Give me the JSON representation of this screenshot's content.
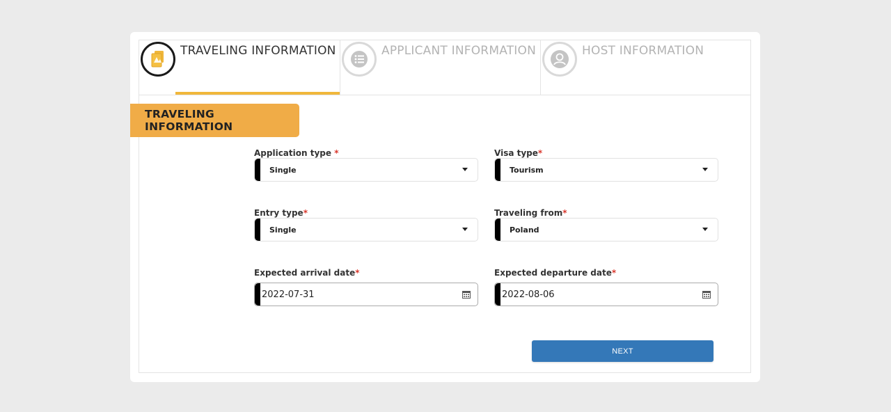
{
  "steps": [
    {
      "label": "TRAVELING INFORMATION",
      "icon": "passport-document-icon",
      "state": "active"
    },
    {
      "label": "APPLICANT INFORMATION",
      "icon": "list-icon",
      "state": "inactive"
    },
    {
      "label": "HOST INFORMATION",
      "icon": "user-icon",
      "state": "inactive"
    }
  ],
  "section": {
    "title": "TRAVELING INFORMATION"
  },
  "fields": {
    "application_type": {
      "label": "Application type ",
      "required": "*",
      "value": "Single"
    },
    "visa_type": {
      "label": "Visa type",
      "required": "*",
      "value": "Tourism"
    },
    "entry_type": {
      "label": "Entry type",
      "required": "*",
      "value": "Single"
    },
    "traveling_from": {
      "label": "Traveling from",
      "required": "*",
      "value": "Poland"
    },
    "arrival_date": {
      "label": "Expected arrival date",
      "required": "*",
      "value": "2022-07-31"
    },
    "departure_date": {
      "label": "Expected departure date",
      "required": "*",
      "value": "2022-08-06"
    }
  },
  "actions": {
    "next_label": "NEXT"
  },
  "colors": {
    "accent": "#f0ac47",
    "step_underline": "#f0b73b",
    "primary_button": "#3478b8",
    "required": "#d9382d"
  }
}
